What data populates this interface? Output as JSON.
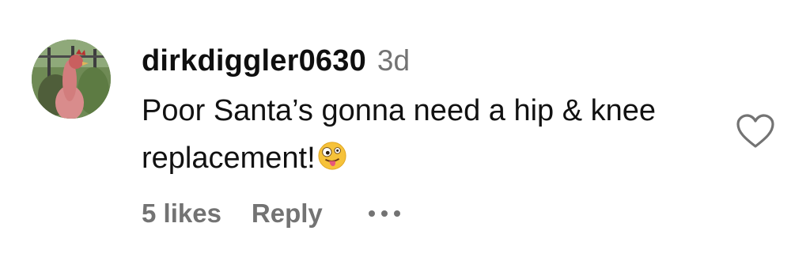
{
  "comment": {
    "username": "dirkdiggler0630",
    "timestamp": "3d",
    "text": "Poor Santa’s gonna need a hip & knee replacement!",
    "emoji": "zany-face-emoji",
    "likes": "5 likes",
    "reply_label": "Reply",
    "more_icon": "more-options-icon",
    "like_icon": "heart-outline-icon"
  },
  "colors": {
    "text": "#111111",
    "muted": "#737373",
    "heart_stroke": "#737373"
  }
}
